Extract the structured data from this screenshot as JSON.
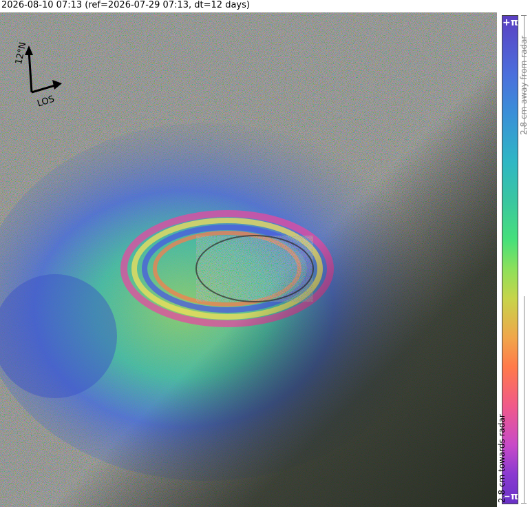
{
  "title": "2026-08-10 07:13 (ref=2026-07-29 07:13, dt=12 days)",
  "map": {
    "north_label": "12°N",
    "los_label": "LOS",
    "icons": [
      "north-arrow-icon",
      "los-arrow-icon"
    ]
  },
  "colorbar": {
    "top_end": "+π",
    "bottom_end": "−π",
    "top_label": "2.8 cm away from radar",
    "bottom_label": "2.8 cm towards radar",
    "colors": [
      "#5b3fc2",
      "#3a8fd8",
      "#2fb7c4",
      "#47e07a",
      "#c7d44a",
      "#ff7a4a",
      "#c84ac8",
      "#6a32c8"
    ]
  }
}
